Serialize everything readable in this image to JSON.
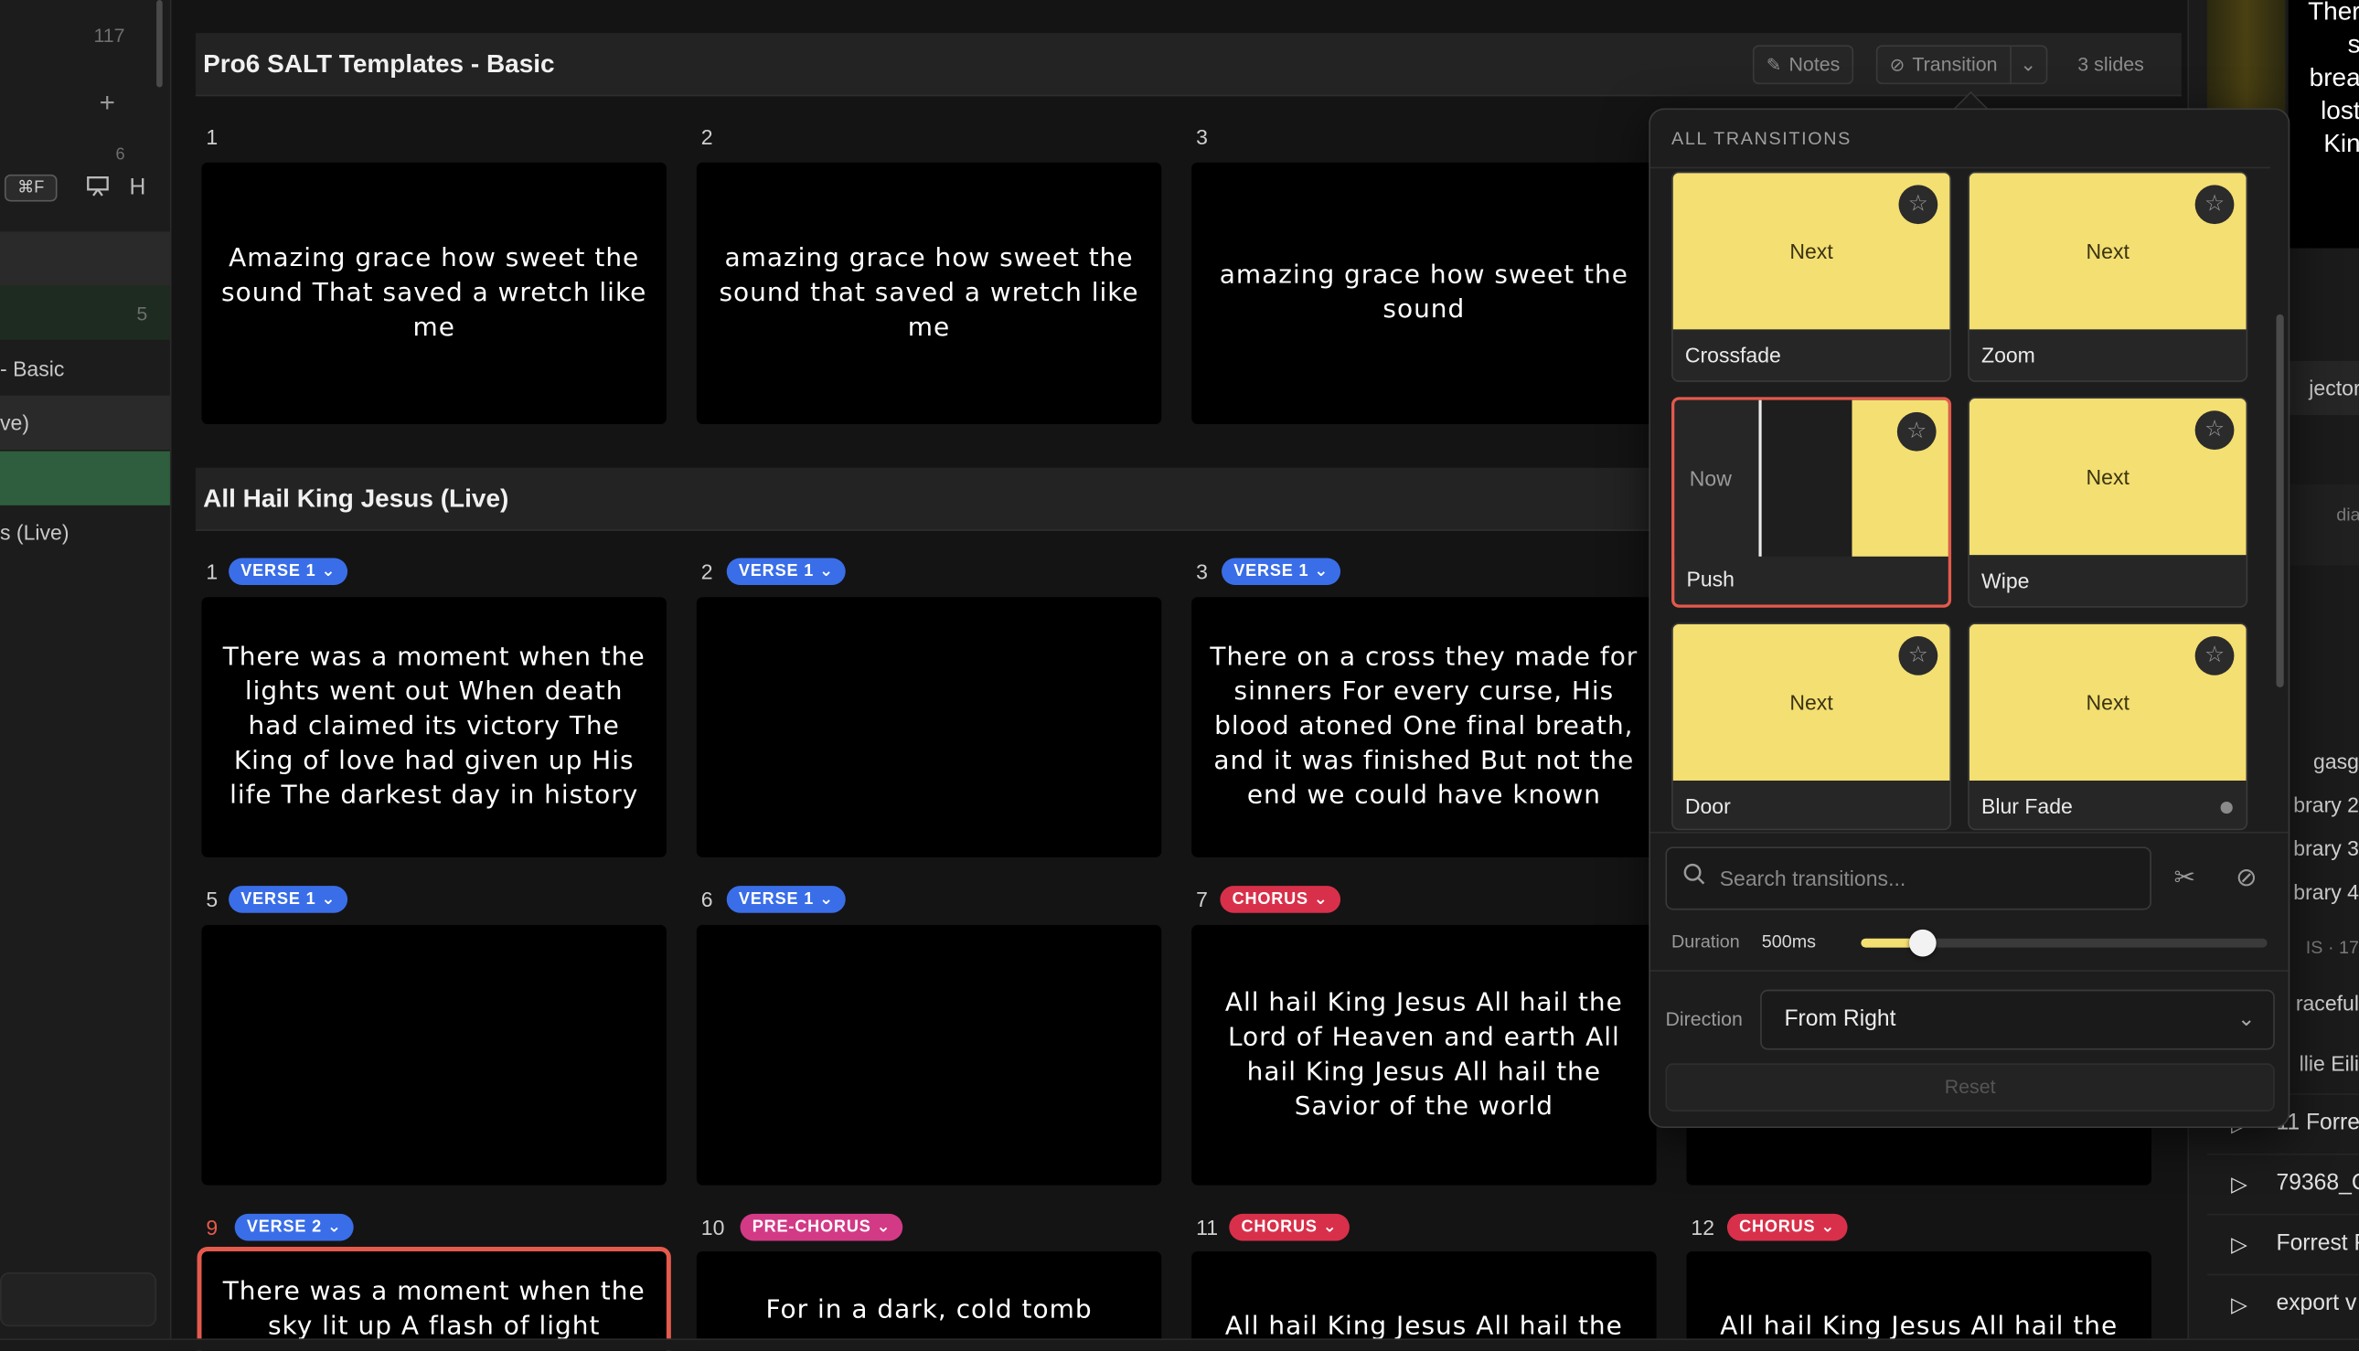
{
  "sidebar": {
    "count_top": "117",
    "count_mid": "6",
    "count_green": "5",
    "search_shortcut": "⌘F",
    "h_label": "H",
    "item_basic": "- Basic",
    "item_live_a": "ve)",
    "item_live_b": "s (Live)"
  },
  "header": {
    "group1_title": "Pro6 SALT Templates - Basic",
    "notes_label": "Notes",
    "transition_label": "Transition",
    "slides_count": "3 slides"
  },
  "group1": {
    "slides": [
      {
        "num": "1",
        "text": "Amazing grace how sweet the sound That saved a wretch like me"
      },
      {
        "num": "2",
        "text": "amazing grace how sweet the sound that saved a wretch like me"
      },
      {
        "num": "3",
        "text": "amazing grace how sweet the sound"
      }
    ]
  },
  "group2": {
    "title": "All Hail King Jesus (Live)",
    "slides": [
      {
        "num": "1",
        "label": "VERSE 1",
        "text": "There was a moment when the lights went out When death had claimed its victory The King of love had given up His life The darkest day in history"
      },
      {
        "num": "2",
        "label": "VERSE 1",
        "text": ""
      },
      {
        "num": "3",
        "label": "VERSE 1",
        "text": "There on a cross they made for sinners For every curse, His blood atoned One final breath, and it was finished But not the end we could have known"
      },
      {
        "num": "5",
        "label": "VERSE 1",
        "text": ""
      },
      {
        "num": "6",
        "label": "VERSE 1",
        "text": ""
      },
      {
        "num": "7",
        "label": "CHORUS",
        "text": "All hail King Jesus All hail the Lord of Heaven and earth All hail King Jesus All hail the Savior of the world"
      },
      {
        "num": "9",
        "label": "VERSE 2",
        "text": "There was a moment when the sky lit up A flash of light"
      },
      {
        "num": "10",
        "label": "PRE-CHORUS",
        "text": "For in a dark, cold tomb"
      },
      {
        "num": "11",
        "label": "CHORUS",
        "text": "All hail King Jesus All hail the"
      },
      {
        "num": "12",
        "label": "CHORUS",
        "text": "All hail King Jesus All hail the"
      }
    ]
  },
  "transitions": {
    "title": "ALL TRANSITIONS",
    "next_label": "Next",
    "now_label": "Now",
    "items": [
      {
        "name": "Crossfade"
      },
      {
        "name": "Zoom"
      },
      {
        "name": "Push"
      },
      {
        "name": "Wipe"
      },
      {
        "name": "Door"
      },
      {
        "name": "Blur Fade"
      }
    ],
    "selected": "Push",
    "search_placeholder": "Search transitions...",
    "duration_label": "Duration",
    "duration_value": "500ms",
    "duration_fraction": 0.12,
    "direction_label": "Direction",
    "direction_value": "From Right",
    "reset_label": "Reset"
  },
  "right_panel": {
    "preview_lines": [
      "Ther",
      "s",
      "brea",
      "lost",
      "Kin"
    ],
    "items": [
      "jector",
      "dia",
      "gasg",
      "brary 2",
      "brary 3",
      "brary 4",
      "IS · 17",
      "raceful",
      "llie Eili"
    ],
    "media": [
      "11 Forre",
      "79368_C",
      "Forrest F",
      "export v"
    ]
  },
  "colors": {
    "accent_yellow": "#f4df72",
    "selection_red": "#e45a4c",
    "verse_blue": "#3a6ee8",
    "chorus_red": "#d8304a",
    "prechorus_pink": "#d23a86"
  }
}
